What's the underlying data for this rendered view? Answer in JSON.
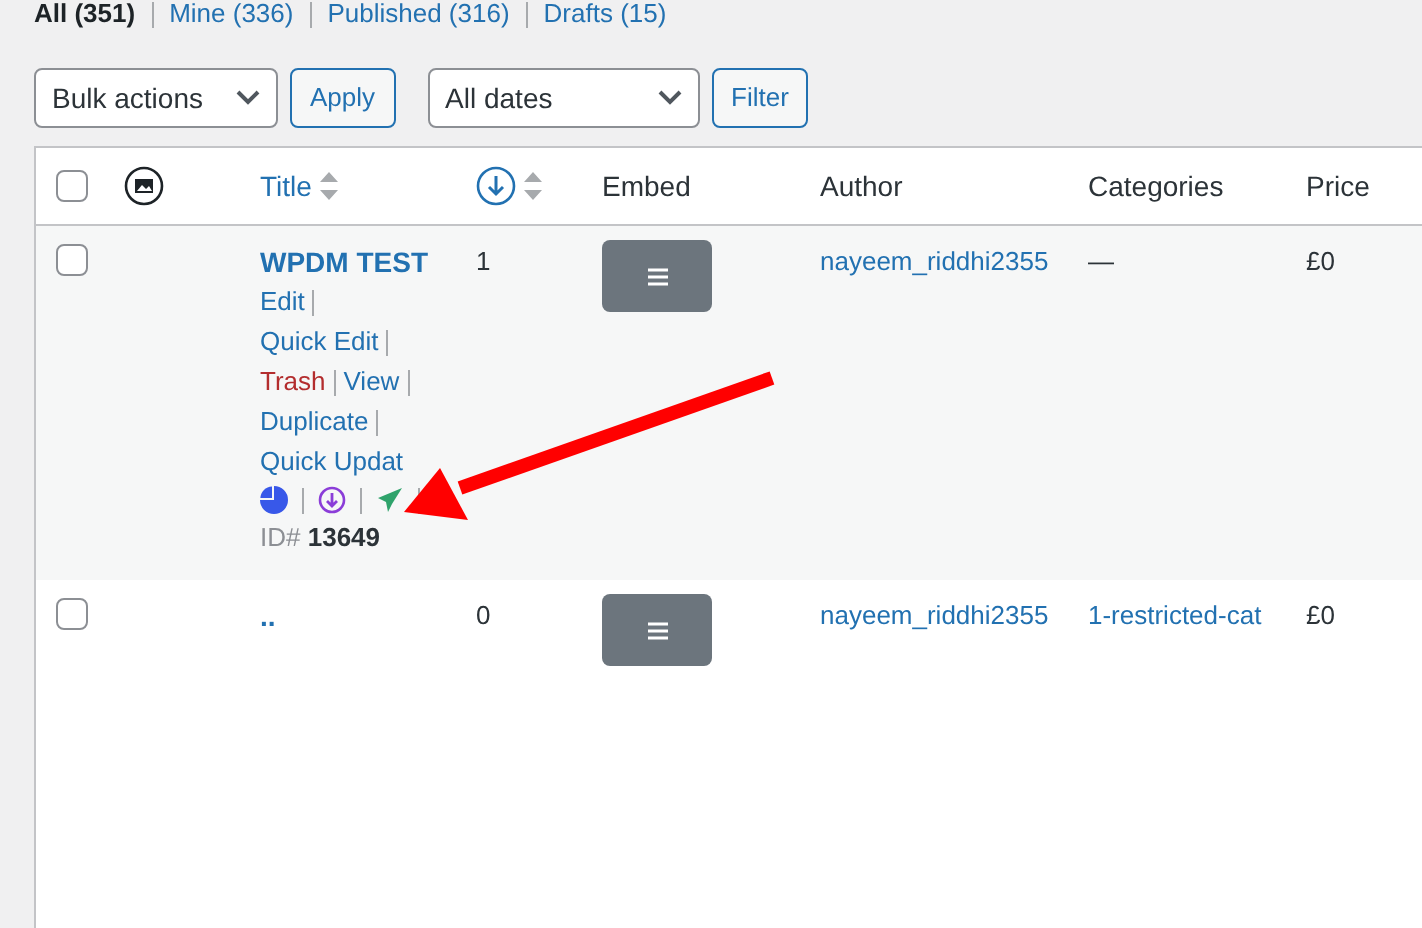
{
  "views": [
    {
      "label": "All (351)",
      "selected": true
    },
    {
      "label": "Mine (336)",
      "selected": false
    },
    {
      "label": "Published (316)",
      "selected": false
    },
    {
      "label": "Drafts (15)",
      "selected": false
    }
  ],
  "bulk_actions": {
    "value": "Bulk actions",
    "button": "Apply"
  },
  "date_filter": {
    "value": "All dates",
    "button": "Filter"
  },
  "table": {
    "select_all_checked": false,
    "columns": [
      {
        "label": "Title",
        "sortable": true
      },
      {
        "sortable": true
      },
      {
        "label": "Embed",
        "sortable": false
      },
      {
        "label": "Author",
        "sortable": false
      },
      {
        "label": "Categories",
        "sortable": false
      },
      {
        "label": "Price",
        "sortable": false
      }
    ],
    "rows": [
      {
        "checked": false,
        "title": "WPDM TEST",
        "count": "1",
        "author": "nayeem_riddhi2355",
        "categories": "—",
        "categories_link": false,
        "price": "£0",
        "actions": [
          {
            "label": "Edit",
            "kind": "link"
          },
          {
            "label": "Quick Edit",
            "kind": "link"
          },
          {
            "label": "Trash",
            "kind": "danger"
          },
          {
            "label": "View",
            "kind": "link"
          },
          {
            "label": "Duplicate",
            "kind": "link"
          },
          {
            "label": "Quick Updat",
            "kind": "link"
          }
        ],
        "id_label": "ID#",
        "id": "13649"
      },
      {
        "checked": false,
        "title": "..",
        "count": "0",
        "author": "nayeem_riddhi2355",
        "categories": "1-restricted-cat",
        "categories_link": true,
        "price": "£0"
      }
    ]
  }
}
